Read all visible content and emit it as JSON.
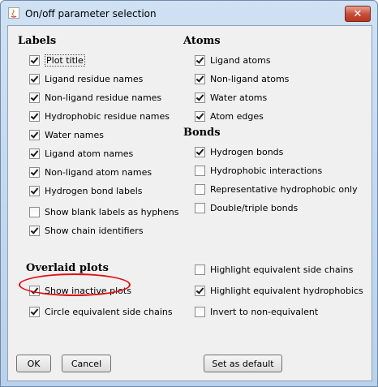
{
  "window": {
    "title": "On/off parameter selection",
    "close_symbol": "✕"
  },
  "labels_section": {
    "title": "Labels",
    "items": [
      {
        "label": "Plot title",
        "checked": true
      },
      {
        "label": "Ligand residue names",
        "checked": true
      },
      {
        "label": "Non-ligand residue names",
        "checked": true
      },
      {
        "label": "Hydrophobic residue names",
        "checked": true
      },
      {
        "label": "Water names",
        "checked": true
      },
      {
        "label": "Ligand atom names",
        "checked": true
      },
      {
        "label": "Non-ligand atom names",
        "checked": true
      },
      {
        "label": "Hydrogen bond labels",
        "checked": true
      },
      {
        "label": "Show blank labels as hyphens",
        "checked": false
      },
      {
        "label": "Show chain identifiers",
        "checked": true
      }
    ]
  },
  "atoms_section": {
    "title": "Atoms",
    "items": [
      {
        "label": "Ligand atoms",
        "checked": true
      },
      {
        "label": "Non-ligand atoms",
        "checked": true
      },
      {
        "label": "Water atoms",
        "checked": true
      },
      {
        "label": "Atom edges",
        "checked": true
      }
    ]
  },
  "bonds_section": {
    "title": "Bonds",
    "items": [
      {
        "label": "Hydrogen bonds",
        "checked": true
      },
      {
        "label": "Hydrophobic interactions",
        "checked": false
      },
      {
        "label": "Representative hydrophobic only",
        "checked": false
      },
      {
        "label": "Double/triple bonds",
        "checked": false
      }
    ]
  },
  "overlaid_section": {
    "title": "Overlaid plots",
    "left_items": [
      {
        "label": "Show inactive plots",
        "checked": true
      },
      {
        "label": "Circle equivalent side chains",
        "checked": true
      }
    ],
    "right_items": [
      {
        "label": "Highlight equivalent side chains",
        "checked": false
      },
      {
        "label": "Highlight equivalent hydrophobics",
        "checked": true
      },
      {
        "label": "Invert to non-equivalent",
        "checked": false
      }
    ]
  },
  "buttons": {
    "ok": "OK",
    "cancel": "Cancel",
    "default": "Set as default"
  },
  "colors": {
    "annotation": "#e01010",
    "titlebar": "#cfe1f3",
    "close": "#c74a37"
  }
}
